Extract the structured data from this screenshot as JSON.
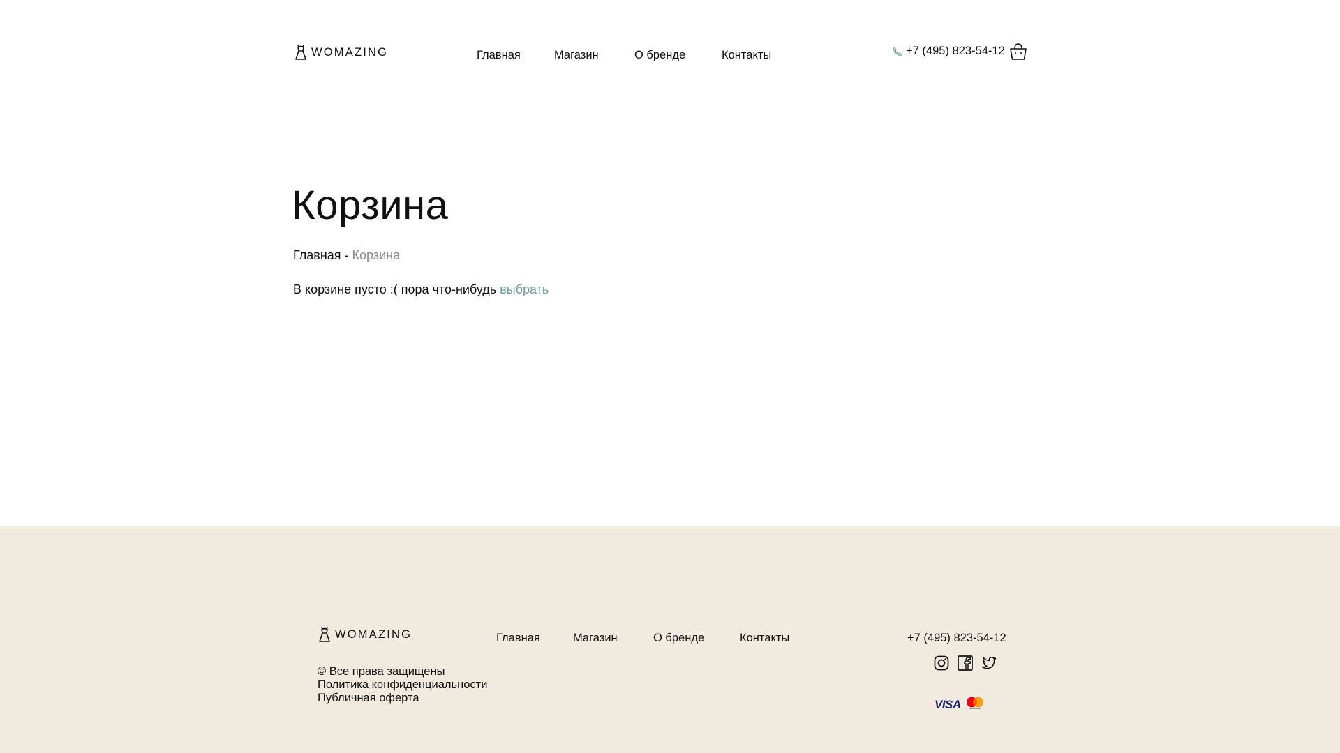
{
  "header": {
    "logo_text": "WOMAZING",
    "nav": [
      "Главная",
      "Магазин",
      "О бренде",
      "Контакты"
    ],
    "phone": "+7 (495) 823-54-12"
  },
  "main": {
    "title": "Корзина",
    "breadcrumb": {
      "home": "Главная",
      "separator": "-",
      "current": "Корзина"
    },
    "empty_text": "В корзине пусто :( пора что-нибудь",
    "empty_link": "выбрать"
  },
  "footer": {
    "logo_text": "WOMAZING",
    "nav": [
      "Главная",
      "Магазин",
      "О бренде",
      "Контакты"
    ],
    "legal": [
      "© Все права защищены",
      "Политика конфиденциальности",
      "Публичная оферта"
    ],
    "phone": "+7 (495) 823-54-12",
    "social_icons": [
      "instagram-icon",
      "facebook-icon",
      "twitter-icon"
    ],
    "payments": {
      "visa": "VISA",
      "mastercard_icon": "mastercard-icon"
    }
  },
  "colors": {
    "accent": "#6e9c9f",
    "footer_bg": "#f1eadf",
    "muted": "#8a8a8a"
  }
}
